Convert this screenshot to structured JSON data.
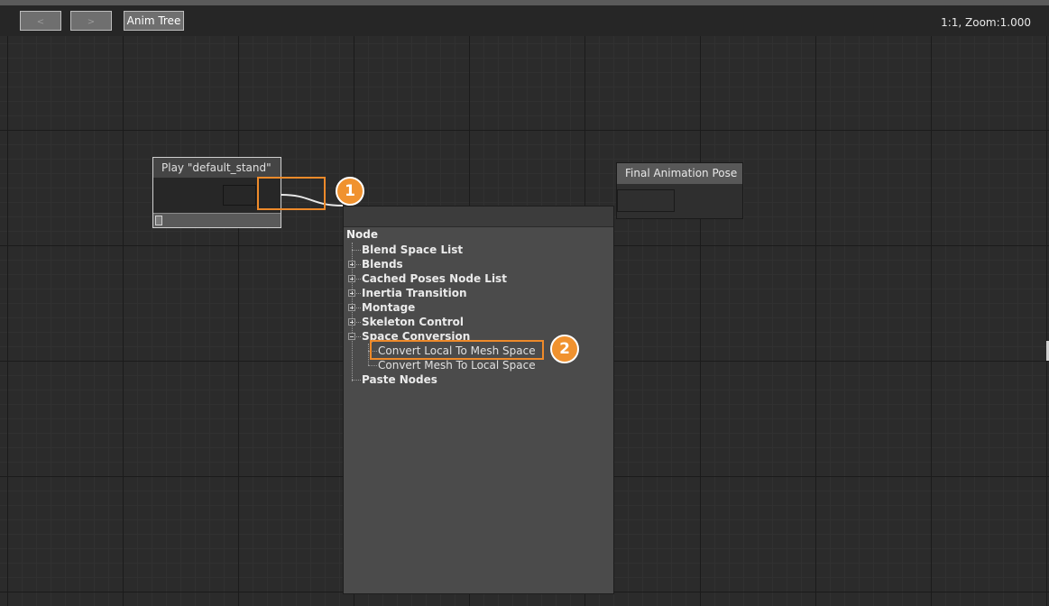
{
  "toolbar": {
    "back_label": "<",
    "forward_label": ">",
    "anim_tree_label": "Anim Tree",
    "zoom_readout": "1:1, Zoom:1.000"
  },
  "nodes": {
    "play_title": "Play \"default_stand\"",
    "final_title": "Final Animation Pose"
  },
  "context_menu": {
    "root": "Node",
    "items": [
      {
        "label": "Blend Space List",
        "expander": "none"
      },
      {
        "label": "Blends",
        "expander": "closed"
      },
      {
        "label": "Cached Poses Node List",
        "expander": "closed"
      },
      {
        "label": "Inertia Transition",
        "expander": "closed"
      },
      {
        "label": "Montage",
        "expander": "closed"
      },
      {
        "label": "Skeleton Control",
        "expander": "closed"
      },
      {
        "label": "Space Conversion",
        "expander": "open",
        "children": [
          "Convert Local To Mesh Space",
          "Convert Mesh To Local Space"
        ]
      },
      {
        "label": "Paste Nodes",
        "expander": "none"
      }
    ]
  },
  "callouts": [
    "1",
    "2"
  ],
  "colors": {
    "accent": "#f0922f",
    "canvas": "#2b2b2b",
    "menu_bg": "#4b4b4b"
  }
}
